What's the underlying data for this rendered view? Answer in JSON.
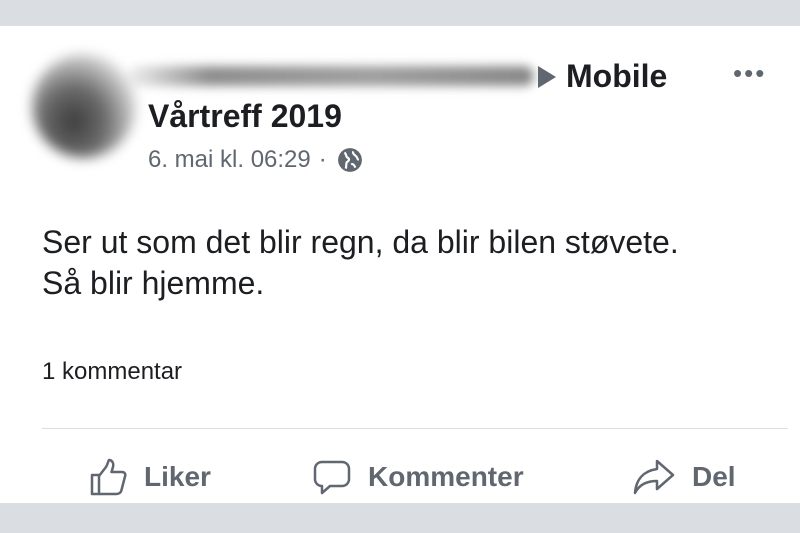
{
  "post": {
    "via_label": "Mobile",
    "group_name": "Vårtreff 2019",
    "timestamp": "6. mai kl. 06:29",
    "meta_separator": "·",
    "text_lines": [
      "Ser ut som det blir regn, da blir bilen støvete.",
      "Så blir hjemme."
    ],
    "comment_count": "1 kommentar",
    "more_icon": "more-horizontal-icon",
    "privacy_icon": "globe-icon"
  },
  "actions": {
    "like_label": "Liker",
    "comment_label": "Kommenter",
    "share_label": "Del"
  },
  "colors": {
    "text": "#1c1e21",
    "secondary": "#606770",
    "separator_band": "#dadde1"
  }
}
